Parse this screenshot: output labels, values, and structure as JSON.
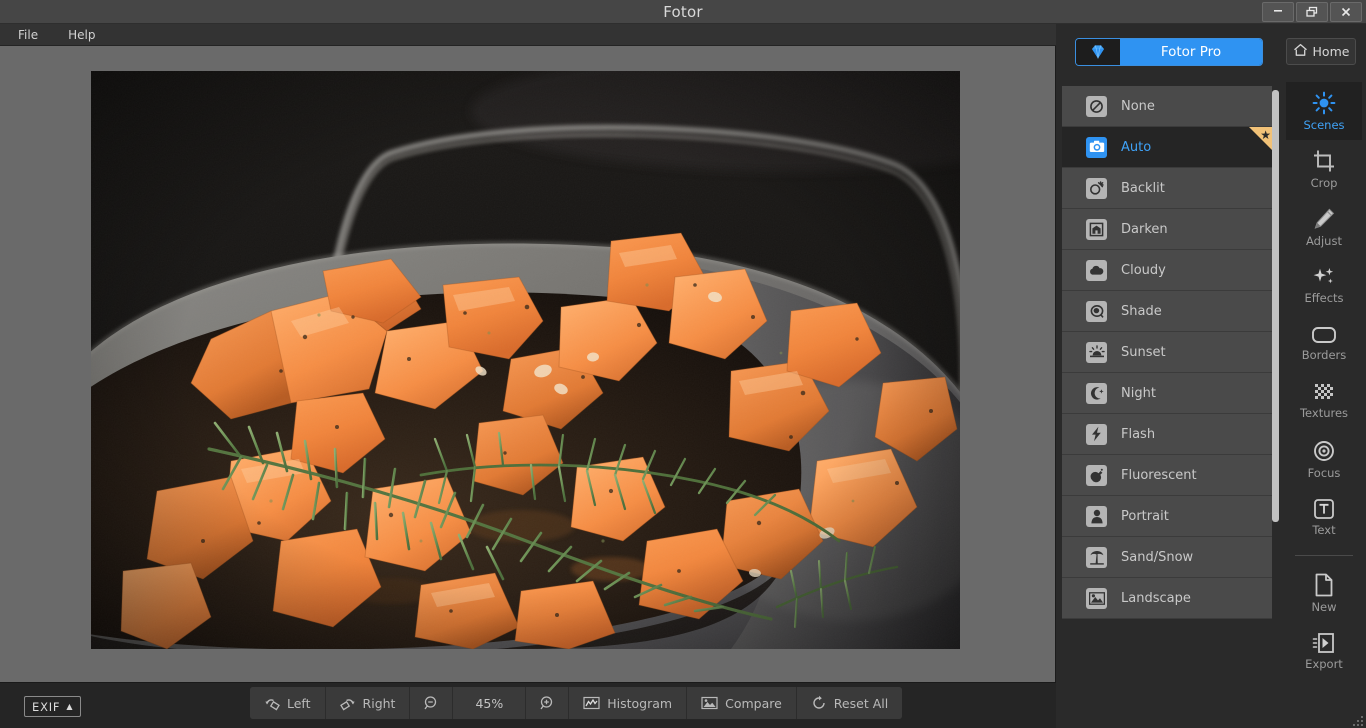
{
  "window": {
    "title": "Fotor",
    "controls": [
      {
        "name": "minimize",
        "label": "—"
      },
      {
        "name": "restore",
        "label": "❐"
      },
      {
        "name": "close",
        "label": "✕"
      }
    ]
  },
  "menubar": {
    "items": [
      {
        "label": "File"
      },
      {
        "label": "Help"
      }
    ]
  },
  "canvas": {
    "image_alt": "Roasted sweet potato cubes with rosemary sprigs in a dark cast iron skillet"
  },
  "bottombar": {
    "exif_label": "EXIF",
    "exif_arrow": "▲",
    "buttons": [
      {
        "name": "rotate-left-button",
        "label": "Left",
        "icon": "rotate-left-icon"
      },
      {
        "name": "rotate-right-button",
        "label": "Right",
        "icon": "rotate-right-icon"
      },
      {
        "name": "zoom-out-button",
        "label": "",
        "icon": "zoom-out-icon"
      },
      {
        "name": "zoom-level",
        "label": "45%",
        "icon": ""
      },
      {
        "name": "zoom-in-button",
        "label": "",
        "icon": "zoom-in-icon"
      },
      {
        "name": "histogram-button",
        "label": "Histogram",
        "icon": "histogram-icon"
      },
      {
        "name": "compare-button",
        "label": "Compare",
        "icon": "compare-icon"
      },
      {
        "name": "reset-all-button",
        "label": "Reset  All",
        "icon": "reset-icon"
      }
    ],
    "zoom_level": "45%"
  },
  "rightpanel": {
    "pro_button": {
      "label": "Fotor Pro",
      "icon": "diamond-icon"
    },
    "home_button": {
      "label": "Home",
      "icon": "home-icon"
    },
    "scenes": [
      {
        "label": "None",
        "icon": "no-entry-icon",
        "selected": false,
        "premium": false
      },
      {
        "label": "Auto",
        "icon": "camera-icon",
        "selected": true,
        "premium": true
      },
      {
        "label": "Backlit",
        "icon": "backlit-icon",
        "selected": false,
        "premium": false
      },
      {
        "label": "Darken",
        "icon": "darken-icon",
        "selected": false,
        "premium": false
      },
      {
        "label": "Cloudy",
        "icon": "cloud-icon",
        "selected": false,
        "premium": false
      },
      {
        "label": "Shade",
        "icon": "shade-icon",
        "selected": false,
        "premium": false
      },
      {
        "label": "Sunset",
        "icon": "sunset-icon",
        "selected": false,
        "premium": false
      },
      {
        "label": "Night",
        "icon": "moon-icon",
        "selected": false,
        "premium": false
      },
      {
        "label": "Flash",
        "icon": "flash-icon",
        "selected": false,
        "premium": false
      },
      {
        "label": "Fluorescent",
        "icon": "bulb-icon",
        "selected": false,
        "premium": false
      },
      {
        "label": "Portrait",
        "icon": "portrait-icon",
        "selected": false,
        "premium": false
      },
      {
        "label": "Sand/Snow",
        "icon": "palm-icon",
        "selected": false,
        "premium": false
      },
      {
        "label": "Landscape",
        "icon": "landscape-icon",
        "selected": false,
        "premium": false
      }
    ],
    "rail": [
      {
        "label": "Scenes",
        "icon": "sun-icon",
        "active": true
      },
      {
        "label": "Crop",
        "icon": "crop-icon",
        "active": false
      },
      {
        "label": "Adjust",
        "icon": "pencil-icon",
        "active": false
      },
      {
        "label": "Effects",
        "icon": "sparkle-icon",
        "active": false
      },
      {
        "label": "Borders",
        "icon": "rounded-rect-icon",
        "active": false
      },
      {
        "label": "Textures",
        "icon": "checker-icon",
        "active": false
      },
      {
        "label": "Focus",
        "icon": "target-icon",
        "active": false
      },
      {
        "label": "Text",
        "icon": "text-icon",
        "active": false
      },
      {
        "label": "New",
        "icon": "page-icon",
        "active": false
      },
      {
        "label": "Export",
        "icon": "export-icon",
        "active": false
      }
    ]
  },
  "colors": {
    "accent_blue": "#2f93f2",
    "premium_gold": "#f2c278",
    "panel_bg": "#2a2a2a",
    "row_bg": "#4a4a4a",
    "canvas_bg": "#6a6a6a"
  }
}
